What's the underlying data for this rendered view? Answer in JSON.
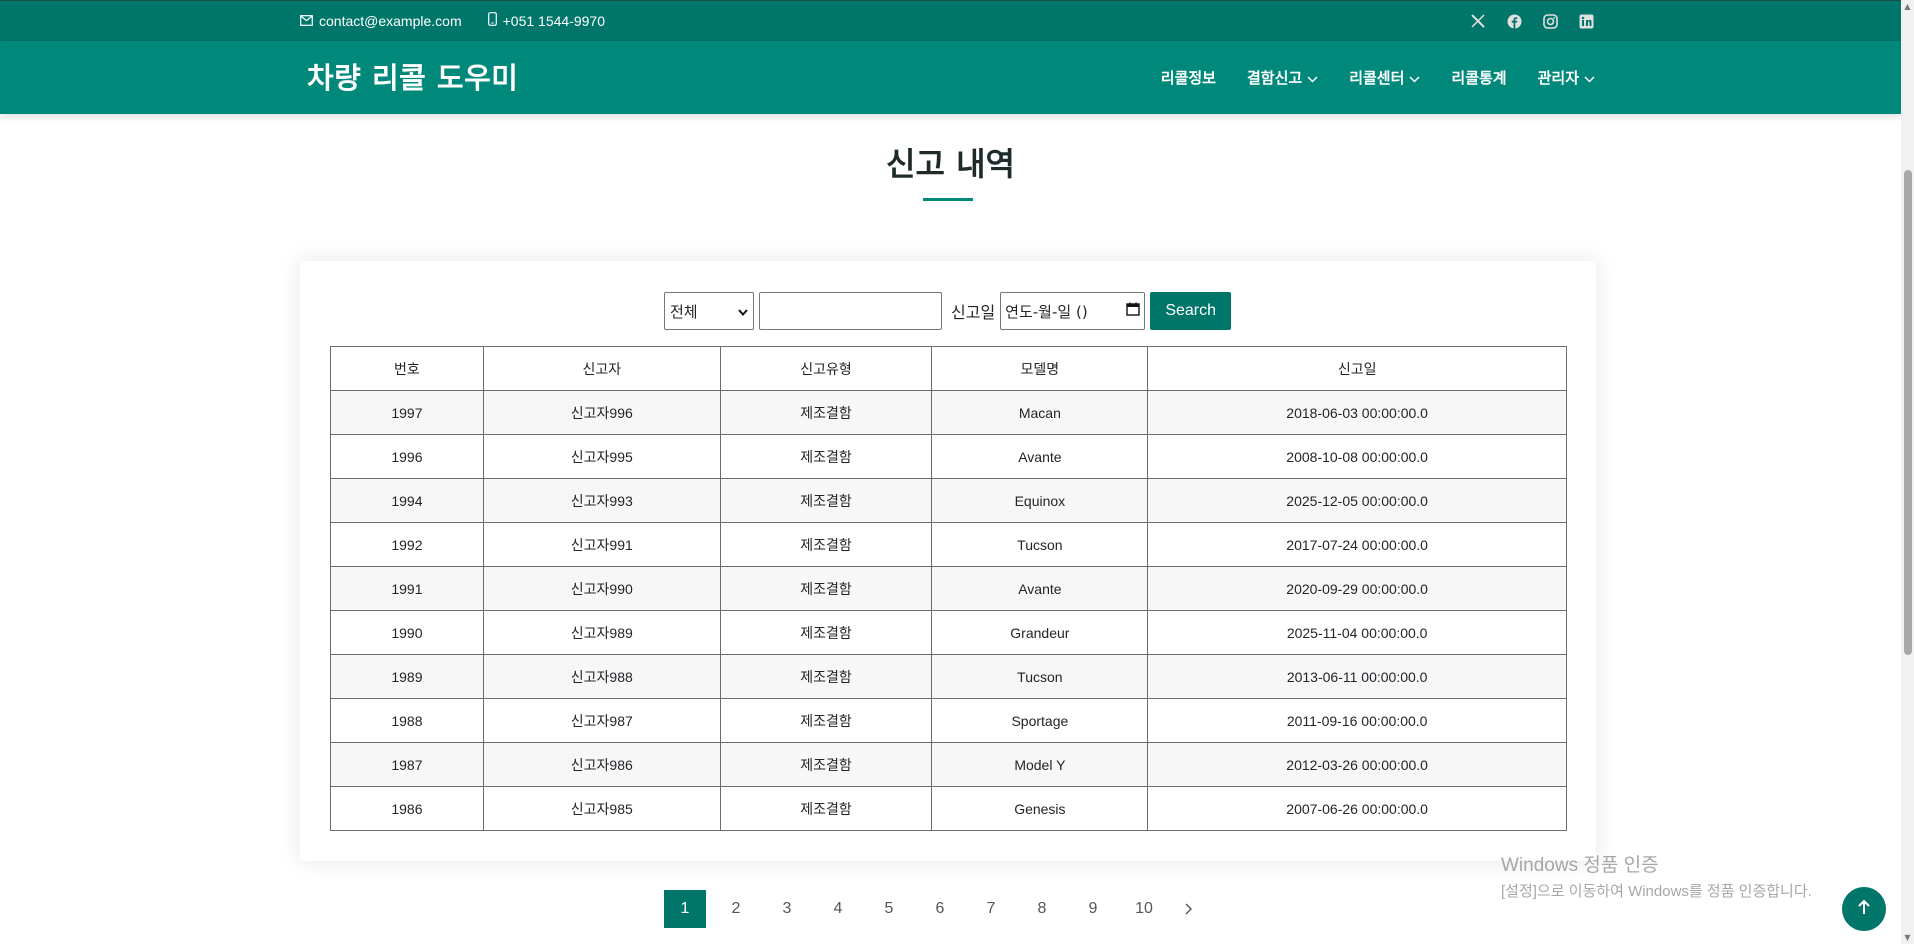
{
  "topbar": {
    "email": "contact@example.com",
    "phone": "+051 1544-9970",
    "social_icons": [
      "x-icon",
      "facebook-icon",
      "instagram-icon",
      "linkedin-icon"
    ]
  },
  "header": {
    "logo": "차량 리콜 도우미",
    "nav": [
      {
        "label": "리콜정보",
        "dropdown": false
      },
      {
        "label": "결함신고",
        "dropdown": true
      },
      {
        "label": "리콜센터",
        "dropdown": true
      },
      {
        "label": "리콜통계",
        "dropdown": false
      },
      {
        "label": "관리자",
        "dropdown": true
      }
    ]
  },
  "page": {
    "title": "신고 내역"
  },
  "search": {
    "category_selected": "전체",
    "keyword_value": "",
    "date_label": "신고일",
    "date_placeholder": "연도-월-일 ()",
    "button_label": "Search"
  },
  "table": {
    "headers": [
      "번호",
      "신고자",
      "신고유형",
      "모델명",
      "신고일"
    ],
    "rows": [
      [
        "1997",
        "신고자996",
        "제조결함",
        "Macan",
        "2018-06-03 00:00:00.0"
      ],
      [
        "1996",
        "신고자995",
        "제조결함",
        "Avante",
        "2008-10-08 00:00:00.0"
      ],
      [
        "1994",
        "신고자993",
        "제조결함",
        "Equinox",
        "2025-12-05 00:00:00.0"
      ],
      [
        "1992",
        "신고자991",
        "제조결함",
        "Tucson",
        "2017-07-24 00:00:00.0"
      ],
      [
        "1991",
        "신고자990",
        "제조결함",
        "Avante",
        "2020-09-29 00:00:00.0"
      ],
      [
        "1990",
        "신고자989",
        "제조결함",
        "Grandeur",
        "2025-11-04 00:00:00.0"
      ],
      [
        "1989",
        "신고자988",
        "제조결함",
        "Tucson",
        "2013-06-11 00:00:00.0"
      ],
      [
        "1988",
        "신고자987",
        "제조결함",
        "Sportage",
        "2011-09-16 00:00:00.0"
      ],
      [
        "1987",
        "신고자986",
        "제조결함",
        "Model Y",
        "2012-03-26 00:00:00.0"
      ],
      [
        "1986",
        "신고자985",
        "제조결함",
        "Genesis",
        "2007-06-26 00:00:00.0"
      ]
    ]
  },
  "pagination": {
    "pages": [
      "1",
      "2",
      "3",
      "4",
      "5",
      "6",
      "7",
      "8",
      "9",
      "10"
    ],
    "active": "1"
  },
  "watermark": {
    "line1": "Windows 정품 인증",
    "line2": "[설정]으로 이동하여 Windows를 정품 인증합니다."
  },
  "colors": {
    "topbar": "#00766a",
    "header": "#00897b",
    "accent": "#00766a"
  }
}
